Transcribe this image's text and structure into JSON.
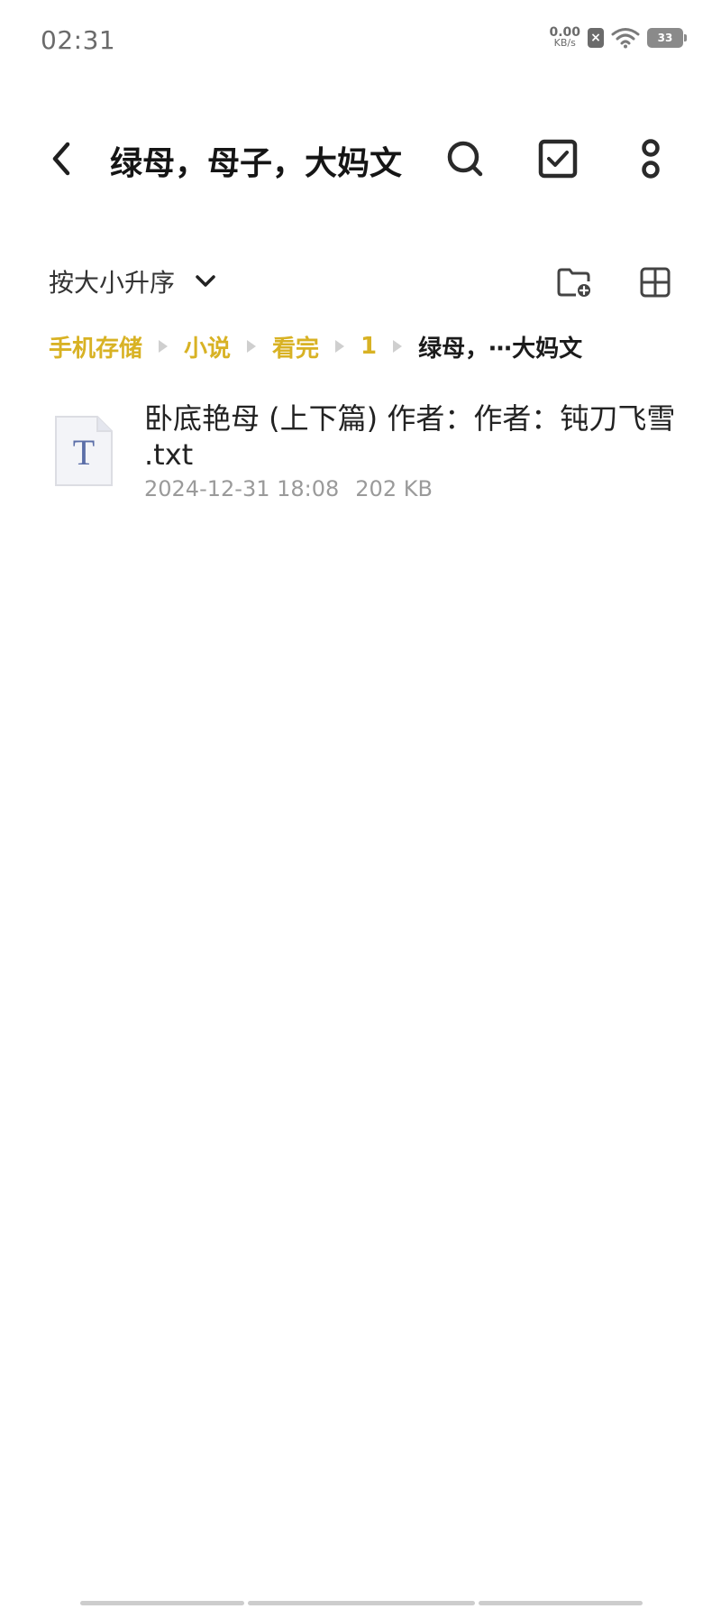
{
  "status_bar": {
    "time": "02:31",
    "net_speed_value": "0.00",
    "net_speed_unit": "KB/s",
    "sim_label": "×",
    "battery": "33"
  },
  "header": {
    "title": "绿母，母子，大妈文"
  },
  "toolbar": {
    "sort_label": "按大小升序"
  },
  "breadcrumb": {
    "items": [
      "手机存储",
      "小说",
      "看完",
      "1"
    ],
    "current": "绿母，⋯大妈文"
  },
  "files": [
    {
      "name": "卧底艳母 (上下篇) 作者：作者：钝刀飞雪 .txt",
      "date": "2024-12-31 18:08",
      "size": "202 KB",
      "icon_letter": "T"
    }
  ],
  "colors": {
    "accent": "#d8b224",
    "text": "#1b1b1b",
    "meta": "#9a9a9a"
  }
}
